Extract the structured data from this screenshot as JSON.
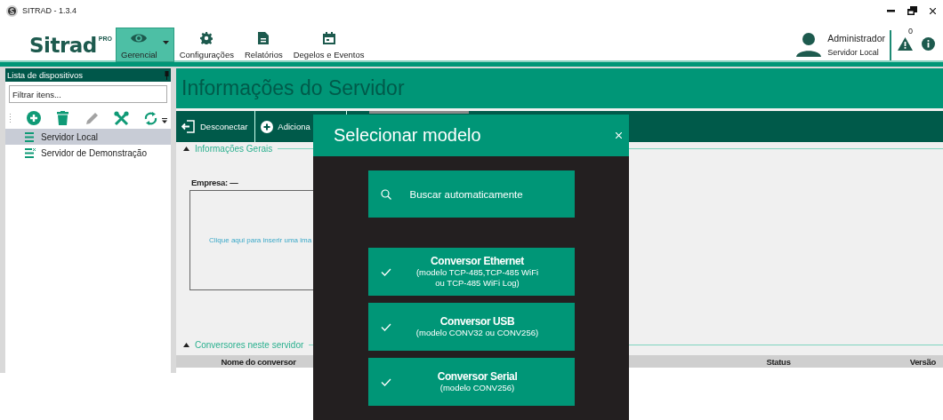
{
  "window": {
    "title": "SITRAD - 1.3.4"
  },
  "ribbon": {
    "logo": "Sitrad",
    "logo_badge": "PRO",
    "tabs": [
      {
        "label": "Gerencial",
        "kind": "eye",
        "selected": true,
        "dropdown": true
      },
      {
        "label": "Configurações",
        "kind": "gear",
        "selected": false,
        "dropdown": false
      },
      {
        "label": "Relatórios",
        "kind": "document",
        "selected": false,
        "dropdown": false
      },
      {
        "label": "Degelos e Eventos",
        "kind": "calendar",
        "selected": false,
        "dropdown": false
      }
    ]
  },
  "user": {
    "name": "Administrador",
    "server": "Servidor Local"
  },
  "alerts": {
    "count": "0"
  },
  "sidebar": {
    "title": "Lista de dispositivos",
    "filter_placeholder": "Filtrar itens...",
    "tools": [
      {
        "kind": "add",
        "disabled": false
      },
      {
        "kind": "delete",
        "disabled": false
      },
      {
        "kind": "edit",
        "disabled": true
      },
      {
        "kind": "tools",
        "disabled": false
      },
      {
        "kind": "sync",
        "disabled": false
      }
    ],
    "items": [
      {
        "label": "Servidor Local",
        "kind": "server",
        "selected": true
      },
      {
        "label": "Servidor de Demonstração",
        "kind": "demo",
        "selected": false
      }
    ]
  },
  "content": {
    "title": "Informações do Servidor",
    "actions": [
      {
        "label": "Desconectar",
        "kind": "disconnect"
      },
      {
        "label": "Adiciona",
        "kind": "add"
      }
    ],
    "general": {
      "heading": "Informações Gerais",
      "expanded": true,
      "company": "Empresa: —",
      "image_hint": "Clique aqui para inserir uma ima"
    },
    "converters": {
      "heading": "Conversores neste servidor",
      "expanded": true,
      "columns": [
        "Nome do conversor",
        "Status",
        "Versão"
      ]
    }
  },
  "dialog": {
    "title": "Selecionar modelo",
    "search_button": "Buscar automaticamente",
    "options": [
      {
        "title": "Conversor Ethernet",
        "subtitle": [
          "(modelo TCP-485,TCP-485 WiFi",
          "ou TCP-485 WiFi Log)"
        ]
      },
      {
        "title": "Conversor USB",
        "subtitle": [
          "(modelo CONV32 ou CONV256)"
        ]
      },
      {
        "title": "Conversor Serial",
        "subtitle": [
          "(modelo CONV256)"
        ]
      }
    ]
  }
}
